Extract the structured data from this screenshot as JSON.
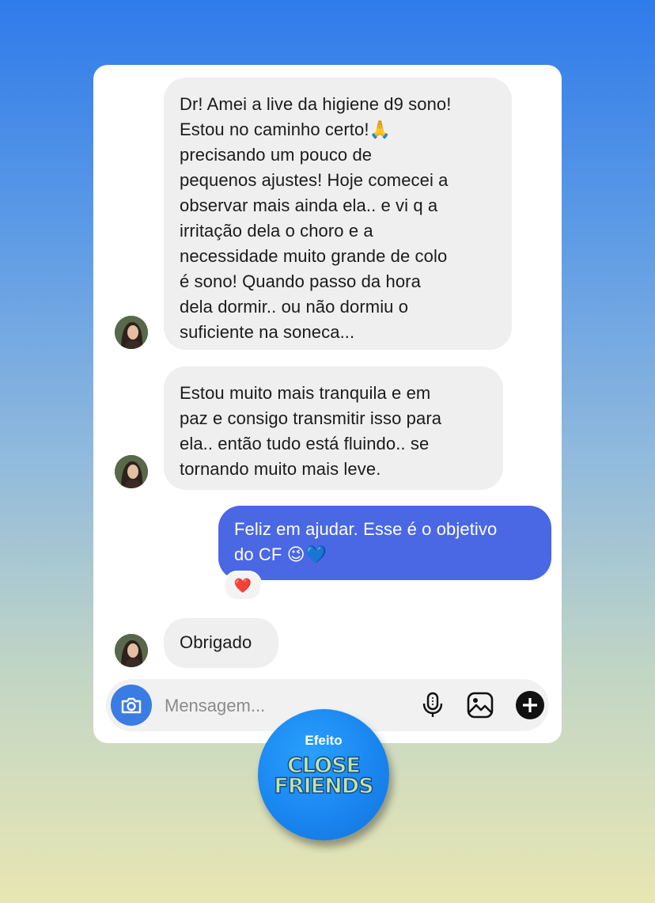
{
  "messages": [
    {
      "direction": "incoming",
      "text": "Dr! Amei a live da higiene d9 sono!\nEstou no caminho certo!🙏\nprecisando um pouco de\npequenos ajustes! Hoje comecei a\nobservar mais ainda ela.. e vi q a\nirritação dela o choro e a\nnecessidade muito grande de colo\né sono! Quando passo da hora\ndela dormir.. ou não dormiu o\nsuficiente na soneca..."
    },
    {
      "direction": "incoming",
      "text": "Estou muito mais tranquila e em\npaz e consigo transmitir isso para\nela.. então tudo está fluindo.. se\ntornando muito mais leve."
    },
    {
      "direction": "outgoing",
      "text": "Feliz em ajudar. Esse é o objetivo\ndo CF 😉💙",
      "reaction": "❤️"
    },
    {
      "direction": "incoming",
      "text": "Obrigado"
    }
  ],
  "composer": {
    "placeholder": "Mensagem...",
    "icons": [
      "camera-icon",
      "microphone-icon",
      "gallery-icon",
      "plus-icon"
    ],
    "camera_color": "#3b7be4"
  },
  "badge": {
    "top_text": "Efeito",
    "line1": "CLOSE",
    "line2": "FRIENDS"
  },
  "colors": {
    "incoming_bubble": "#efefef",
    "outgoing_bubble": "#4a67e4",
    "background_top": "#2f7bea",
    "background_bottom": "#e8e6b3"
  }
}
